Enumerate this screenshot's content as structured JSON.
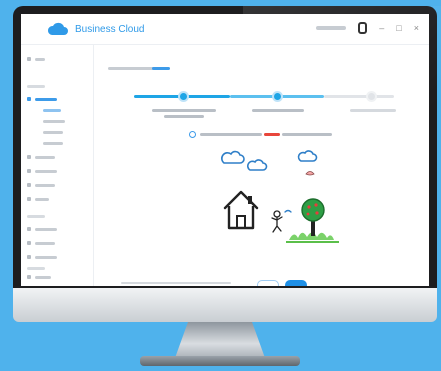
{
  "app": {
    "brand": "Business Cloud",
    "brand_color": "#2f9ae8",
    "logo_icon": "cloud-icon",
    "window_controls": [
      "–",
      "□",
      "×"
    ]
  },
  "background_color": "#4fb2ec",
  "sidebar": {
    "items": [
      {
        "icon": "home-icon",
        "label": "",
        "active": false
      },
      {
        "icon": "folder-icon",
        "label": "",
        "active": true,
        "children": [
          "",
          "",
          "",
          ""
        ]
      },
      {
        "icon": "list-icon",
        "label": "",
        "active": false
      },
      {
        "icon": "list-icon",
        "label": "",
        "active": false
      },
      {
        "icon": "list-icon",
        "label": "",
        "active": false
      },
      {
        "icon": "list-icon",
        "label": "",
        "active": false
      },
      {
        "icon": "list-icon",
        "label": "",
        "active": false
      },
      {
        "icon": "list-icon",
        "label": "",
        "active": false
      },
      {
        "icon": "list-icon",
        "label": "",
        "active": false
      },
      {
        "icon": "list-icon",
        "label": "",
        "active": false
      },
      {
        "icon": "list-icon",
        "label": "",
        "active": false
      }
    ]
  },
  "steps": [
    {
      "state": "done",
      "caption": ""
    },
    {
      "state": "done",
      "caption": ""
    },
    {
      "state": "todo",
      "caption": ""
    }
  ],
  "accent_color": "#1e8fe6",
  "warning_color": "#e8463b",
  "illustration": {
    "elements": [
      "house-icon",
      "tree-icon",
      "cloud-icon",
      "cloud-icon",
      "cloud-icon",
      "person-icon",
      "bird-icon",
      "grass-icon"
    ]
  },
  "buttons": {
    "back_label": "",
    "next_label": ""
  }
}
